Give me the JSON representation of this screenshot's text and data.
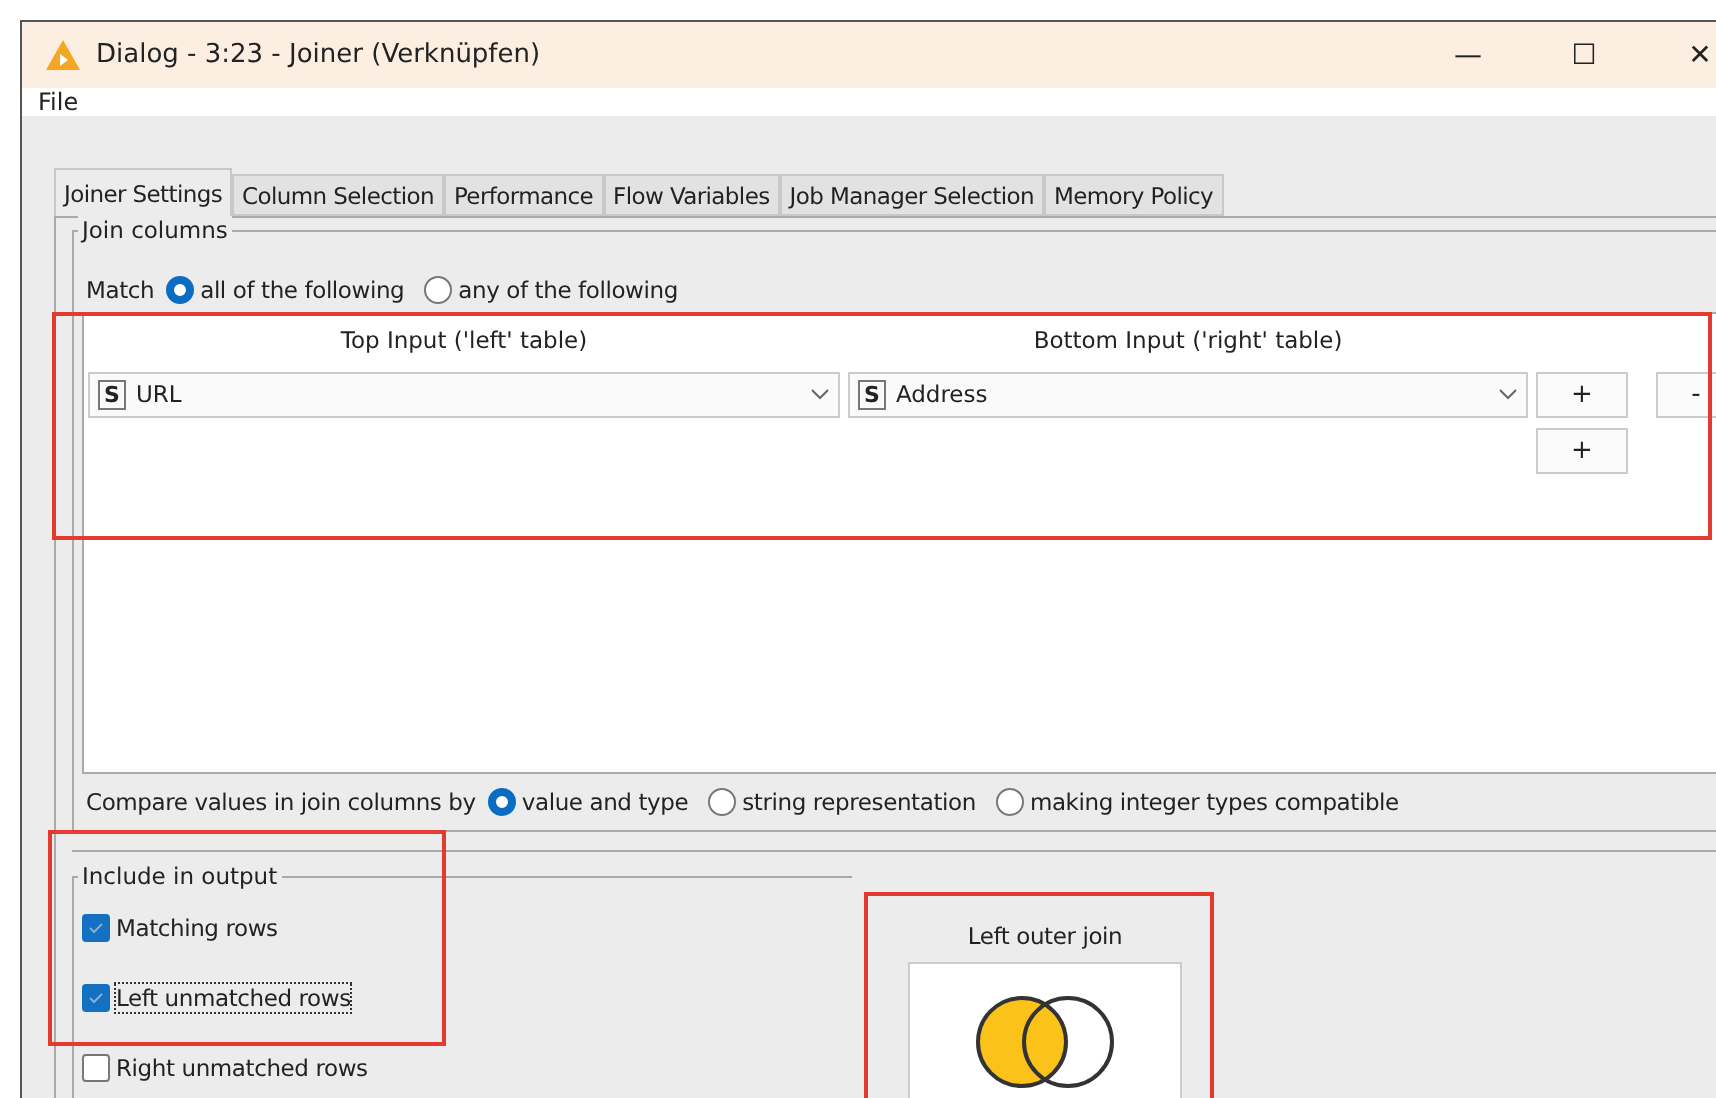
{
  "window": {
    "title": "Dialog - 3:23 - Joiner (Verknüpfen)",
    "controls": [
      "—",
      "☐",
      "✕"
    ]
  },
  "menu": [
    "File"
  ],
  "tabs": [
    {
      "label": "Joiner Settings",
      "selected": true
    },
    {
      "label": "Column Selection",
      "selected": false
    },
    {
      "label": "Performance",
      "selected": false
    },
    {
      "label": "Flow Variables",
      "selected": false
    },
    {
      "label": "Job Manager Selection",
      "selected": false
    },
    {
      "label": "Memory Policy",
      "selected": false
    }
  ],
  "join_columns": {
    "legend": "Join columns",
    "match_label": "Match",
    "match_options": [
      {
        "label": "all of the following",
        "selected": true
      },
      {
        "label": "any of the following",
        "selected": false
      }
    ],
    "headers": [
      "Top Input ('left' table)",
      "Bottom Input ('right' table)"
    ],
    "rows": [
      {
        "left_type": "S",
        "left": "URL",
        "right_type": "S",
        "right": "Address",
        "buttons": [
          "+",
          "-"
        ]
      }
    ],
    "add_button": "+"
  },
  "compare": {
    "label": "Compare values in join columns by",
    "options": [
      {
        "label": "value and type",
        "selected": true
      },
      {
        "label": "string representation",
        "selected": false
      },
      {
        "label": "making integer types compatible",
        "selected": false
      }
    ]
  },
  "include": {
    "legend": "Include in output",
    "items": [
      {
        "label": "Matching rows",
        "checked": true
      },
      {
        "label": "Left unmatched rows",
        "checked": true
      },
      {
        "label": "Right unmatched rows",
        "checked": false
      }
    ]
  },
  "join_preview": {
    "title": "Left outer join",
    "left_filled": true,
    "right_filled": false
  }
}
